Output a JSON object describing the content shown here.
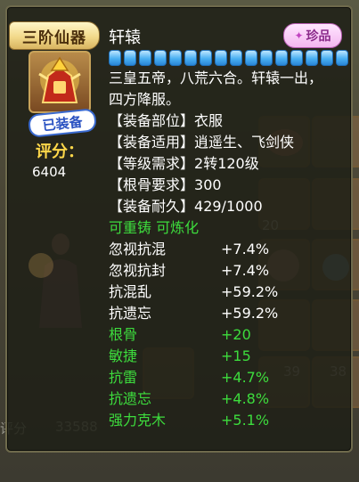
{
  "background": {
    "faded_numbers": [
      "20",
      "39",
      "38",
      "33588"
    ],
    "faded_text": "评分"
  },
  "tooltip": {
    "tier_tag": "三阶仙器",
    "item_name": "轩辕",
    "rarity": "珍品",
    "equipped_badge": "已装备",
    "score_label": "评分：",
    "score_value": "6404",
    "refine_segments": 16,
    "description_lines": [
      "三皇五帝，八荒六合。轩辕一出，",
      "四方降服。"
    ],
    "info": [
      {
        "label": "【装备部位】",
        "value": "衣服"
      },
      {
        "label": "【装备适用】",
        "value": "逍遥生、飞剑侠"
      },
      {
        "label": "【等级需求】",
        "value": "2转120级"
      },
      {
        "label": "【根骨要求】",
        "value": "300"
      },
      {
        "label": "【装备耐久】",
        "value": "429/1000"
      }
    ],
    "flags": "可重铸 可炼化",
    "attributes": [
      {
        "name": "忽视抗混",
        "value": "+7.4%",
        "color": "white"
      },
      {
        "name": "忽视抗封",
        "value": "+7.4%",
        "color": "white"
      },
      {
        "name": "抗混乱",
        "value": "+59.2%",
        "color": "white"
      },
      {
        "name": "抗遗忘",
        "value": "+59.2%",
        "color": "white"
      },
      {
        "name": "根骨",
        "value": "+20",
        "color": "green"
      },
      {
        "name": "敏捷",
        "value": "+15",
        "color": "green"
      },
      {
        "name": "抗雷",
        "value": "+4.7%",
        "color": "green"
      },
      {
        "name": "抗遗忘",
        "value": "+4.8%",
        "color": "green"
      },
      {
        "name": "强力克木",
        "value": "+5.1%",
        "color": "green"
      }
    ]
  },
  "colors": {
    "green_text": "#3ddc3d",
    "score_gold": "#ffd84a",
    "bar_blue": "#4ab0f2",
    "rarity_pink": "#f3b6f0"
  }
}
